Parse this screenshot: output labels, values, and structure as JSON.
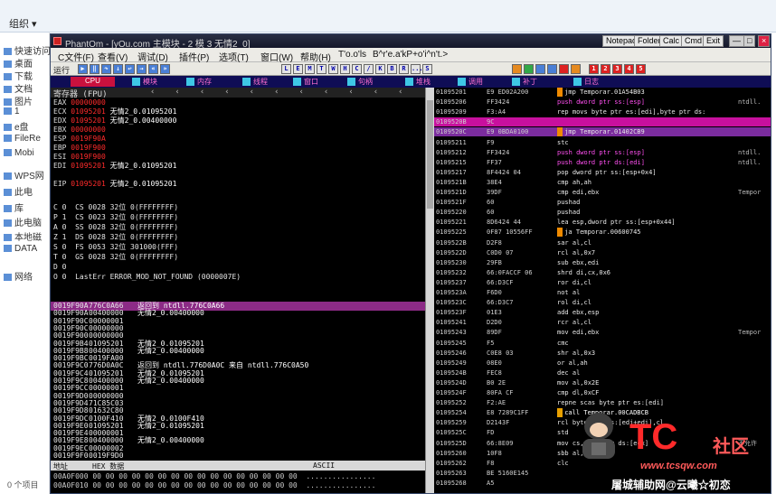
{
  "explorer": {
    "title": "组织 ▾",
    "sidebar": [
      "快速访问",
      "桌面",
      "下载",
      "文档",
      "图片",
      "1",
      "e盘",
      "FileRe",
      "Mobi",
      "WPS网",
      "此电",
      "库",
      "此电脑",
      "本地磁",
      "DATA",
      "网络"
    ],
    "status": "0 个项目"
  },
  "window": {
    "title": "PhantOm - [yOu.com 主模块 - 2 模 3 无情2_0]",
    "title_buttons": [
      "Notepad",
      "Folder",
      "Calc",
      "Cmd",
      "Exit"
    ],
    "menus": [
      "C文件(F)",
      "查看(V)",
      "调试(D)",
      "插件(P)",
      "选项(T)",
      "窗口(W)",
      "帮助(H)",
      "T'o.o'ls",
      "B^r'e.a'kP+o'i^n't.>"
    ],
    "toolbar_label": "运行",
    "toolbar_letters": [
      "L",
      "E",
      "M",
      "T",
      "W",
      "H",
      "C",
      "/",
      "K",
      "B",
      "R",
      "...",
      "S"
    ],
    "toolbar_numbers": [
      "1",
      "2",
      "3",
      "4",
      "5"
    ],
    "tabs": [
      "CPU",
      "模块",
      "内存",
      "线程",
      "窗口",
      "句柄",
      "堆栈",
      "调用",
      "补丁",
      "日志"
    ]
  },
  "registers": {
    "header": "寄存器 (FPU)",
    "rows": [
      {
        "name": "EAX",
        "val": "00000000",
        "comment": ""
      },
      {
        "name": "ECX",
        "val": "01095201",
        "comment": "无情2_0.01095201"
      },
      {
        "name": "EDX",
        "val": "01095201",
        "comment": "无情2_0.00400000"
      },
      {
        "name": "EBX",
        "val": "00000000",
        "comment": ""
      },
      {
        "name": "ESP",
        "val": "0019F90A",
        "comment": ""
      },
      {
        "name": "EBP",
        "val": "0019F900",
        "comment": ""
      },
      {
        "name": "ESI",
        "val": "0019F900",
        "comment": ""
      },
      {
        "name": "EDI",
        "val": "01095201",
        "comment": "无情2_0.01095201"
      },
      {
        "name": "",
        "val": "",
        "comment": ""
      },
      {
        "name": "EIP",
        "val": "01095201",
        "comment": "无情2_0.01095201"
      }
    ],
    "flags": [
      "C 0  CS 0028 32位 0(FFFFFFFF)",
      "P 1  CS 0023 32位 0(FFFFFFFF)",
      "A 0  SS 0028 32位 0(FFFFFFFF)",
      "Z 1  DS 0028 32位 0(FFFFFFFF)",
      "S 0  FS 0053 32位 301000(FFF)",
      "T 0  GS 0028 32位 0(FFFFFFFF)",
      "D 0",
      "O 0  LastErr ERROR_MOD_NOT_FOUND (0000007E)"
    ]
  },
  "stack": [
    {
      "addr": "0019F90A",
      "val": "776C0A66",
      "comment": "返回到 ntdll.776C0A66",
      "hl": true
    },
    {
      "addr": "0019F90A",
      "val": "00400000",
      "comment": "无情2_0.00400000"
    },
    {
      "addr": "0019F90C",
      "val": "00000001",
      "comment": ""
    },
    {
      "addr": "0019F90C",
      "val": "00000000",
      "comment": ""
    },
    {
      "addr": "0019F900",
      "val": "00000000",
      "comment": ""
    },
    {
      "addr": "0019F9B4",
      "val": "01095201",
      "comment": "无情2_0.01095201"
    },
    {
      "addr": "0019F9B8",
      "val": "00400000",
      "comment": "无情2_0.00400000"
    },
    {
      "addr": "0019F9BC",
      "val": "0019FA00",
      "comment": ""
    },
    {
      "addr": "0019F9C0",
      "val": "776D0A0C",
      "comment": "返回到 ntdll.776D0A0C 来自 ntdll.776C0A50"
    },
    {
      "addr": "0019F9C4",
      "val": "01095201",
      "comment": "无情2_0.01095201"
    },
    {
      "addr": "0019F9C8",
      "val": "00400000",
      "comment": "无情2_0.00400000"
    },
    {
      "addr": "0019F9CC",
      "val": "00000001",
      "comment": ""
    },
    {
      "addr": "0019F9D0",
      "val": "00000000",
      "comment": ""
    },
    {
      "addr": "0019F9D4",
      "val": "71C85C03",
      "comment": ""
    },
    {
      "addr": "0019F9D8",
      "val": "01632C80",
      "comment": ""
    },
    {
      "addr": "0019F9DC",
      "val": "0100F410",
      "comment": "无情2_0.0100F410"
    },
    {
      "addr": "0019F9E0",
      "val": "01095201",
      "comment": "无情2_0.01095201"
    },
    {
      "addr": "0019F9E4",
      "val": "00000001",
      "comment": ""
    },
    {
      "addr": "0019F9E8",
      "val": "00400000",
      "comment": "无情2_0.00400000"
    },
    {
      "addr": "0019F9EC",
      "val": "00000002",
      "comment": ""
    },
    {
      "addr": "0019F9F0",
      "val": "0019F9D0",
      "comment": ""
    }
  ],
  "dump": {
    "header_addr": "地址",
    "header_hex": "HEX 数据",
    "header_ascii": "ASCII",
    "rows": [
      "00A0F000 00 00 00 00 00 00 00 00 00 00 00 00 00 00 00 00  ................",
      "00A0F010 00 00 00 00 00 00 00 00 00 00 00 00 00 00 00 00  ................"
    ]
  },
  "disasm": [
    {
      "addr": "01095201",
      "hex": "E9 ED02A200",
      "mn": "jmp Temporar.01A54B03",
      "tag": "jmp",
      "rc": ""
    },
    {
      "addr": "01095206",
      "hex": "FF3424",
      "mn": "dword ptr ss:[esp]",
      "tag": "push",
      "rc": "ntdll."
    },
    {
      "addr": "01095209",
      "hex": "F3:A4",
      "mn": "rep movs byte ptr es:[edi],byte ptr ds:",
      "tag": "",
      "rc": ""
    },
    {
      "addr": "0109520B",
      "hex": "9C",
      "mn": "",
      "tag": "",
      "rc": "",
      "bg": "pink"
    },
    {
      "addr": "0109520C",
      "hex": "E9 0BDA0100",
      "mn": "jmp Temporar.01402CB9",
      "tag": "jmp",
      "rc": "",
      "bg": "purple"
    },
    {
      "addr": "01095211",
      "hex": "F9",
      "mn": "stc",
      "tag": "",
      "rc": ""
    },
    {
      "addr": "01095212",
      "hex": "FF3424",
      "mn": "dword ptr ss:[esp]",
      "tag": "push",
      "rc": "ntdll."
    },
    {
      "addr": "01095215",
      "hex": "FF37",
      "mn": "dword ptr ds:[edi]",
      "tag": "push",
      "rc": "ntdll."
    },
    {
      "addr": "01095217",
      "hex": "8F4424 04",
      "mn": "pop dword ptr ss:[esp+0x4]",
      "tag": "",
      "rc": ""
    },
    {
      "addr": "0109521B",
      "hex": "38E4",
      "mn": "cmp ah,ah",
      "tag": "",
      "rc": ""
    },
    {
      "addr": "0109521D",
      "hex": "39DF",
      "mn": "cmp edi,ebx",
      "tag": "",
      "rc": "Tempor"
    },
    {
      "addr": "0109521F",
      "hex": "60",
      "mn": "pushad",
      "tag": "",
      "rc": ""
    },
    {
      "addr": "01095220",
      "hex": "60",
      "mn": "pushad",
      "tag": "",
      "rc": ""
    },
    {
      "addr": "01095221",
      "hex": "8D6424 44",
      "mn": "lea esp,dword ptr ss:[esp+0x44]",
      "tag": "",
      "rc": ""
    },
    {
      "addr": "01095225",
      "hex": "0F87 10556FF",
      "mn": "ja Temporar.00600745",
      "tag": "ja",
      "rc": ""
    },
    {
      "addr": "0109522B",
      "hex": "D2F8",
      "mn": "sar al,cl",
      "tag": "",
      "rc": ""
    },
    {
      "addr": "0109522D",
      "hex": "C0D0 07",
      "mn": "rcl al,0x7",
      "tag": "",
      "rc": ""
    },
    {
      "addr": "01095230",
      "hex": "29FB",
      "mn": "sub ebx,edi",
      "tag": "",
      "rc": ""
    },
    {
      "addr": "01095232",
      "hex": "66:0FACCF 06",
      "mn": "shrd di,cx,0x6",
      "tag": "",
      "rc": ""
    },
    {
      "addr": "01095237",
      "hex": "66:D3CF",
      "mn": "ror di,cl",
      "tag": "",
      "rc": ""
    },
    {
      "addr": "0109523A",
      "hex": "F6D0",
      "mn": "not al",
      "tag": "",
      "rc": ""
    },
    {
      "addr": "0109523C",
      "hex": "66:D3C7",
      "mn": "rol di,cl",
      "tag": "",
      "rc": ""
    },
    {
      "addr": "0109523F",
      "hex": "01E3",
      "mn": "add ebx,esp",
      "tag": "",
      "rc": ""
    },
    {
      "addr": "01095241",
      "hex": "D2D0",
      "mn": "rcr al,cl",
      "tag": "",
      "rc": ""
    },
    {
      "addr": "01095243",
      "hex": "89DF",
      "mn": "mov edi,ebx",
      "tag": "",
      "rc": "Tempor"
    },
    {
      "addr": "01095245",
      "hex": "F5",
      "mn": "cmc",
      "tag": "",
      "rc": ""
    },
    {
      "addr": "01095246",
      "hex": "C0E8 03",
      "mn": "shr al,0x3",
      "tag": "",
      "rc": ""
    },
    {
      "addr": "01095249",
      "hex": "08E0",
      "mn": "or al,ah",
      "tag": "",
      "rc": ""
    },
    {
      "addr": "0109524B",
      "hex": "FEC8",
      "mn": "dec al",
      "tag": "",
      "rc": ""
    },
    {
      "addr": "0109524D",
      "hex": "B0 2E",
      "mn": "mov al,0x2E",
      "tag": "",
      "rc": ""
    },
    {
      "addr": "0109524F",
      "hex": "80FA CF",
      "mn": "cmp dl,0xCF",
      "tag": "",
      "rc": ""
    },
    {
      "addr": "01095252",
      "hex": "F2:AE",
      "mn": "repne scas byte ptr es:[edi]",
      "tag": "",
      "rc": ""
    },
    {
      "addr": "01095254",
      "hex": "E8 7289C1FF",
      "mn": "call Temporar.00CADBCB",
      "tag": "call",
      "rc": ""
    },
    {
      "addr": "01095259",
      "hex": "D2143F",
      "mn": "rcl byte ptr ds:[edi+edi],cl",
      "tag": "",
      "rc": ""
    },
    {
      "addr": "0109525C",
      "hex": "FD",
      "mn": "std",
      "tag": "",
      "rc": ""
    },
    {
      "addr": "0109525D",
      "hex": "66:8E09",
      "mn": "mov cs,word ptr ds:[ecx]",
      "tag": "",
      "rc": "不允许"
    },
    {
      "addr": "01095260",
      "hex": "10F8",
      "mn": "sbb al,bh",
      "tag": "",
      "rc": ""
    },
    {
      "addr": "01095262",
      "hex": "F8",
      "mn": "clc",
      "tag": "",
      "rc": ""
    },
    {
      "addr": "01095263",
      "hex": "BE 5160E145",
      "mn": "",
      "tag": "",
      "rc": ""
    },
    {
      "addr": "01095268",
      "hex": "A5",
      "mn": "",
      "tag": "",
      "rc": ""
    }
  ],
  "watermark": {
    "logo": "TC",
    "logo_suffix": "社区",
    "url": "www.tcsqw.com",
    "text": "屠城辅助网@云曦☆初恋"
  }
}
